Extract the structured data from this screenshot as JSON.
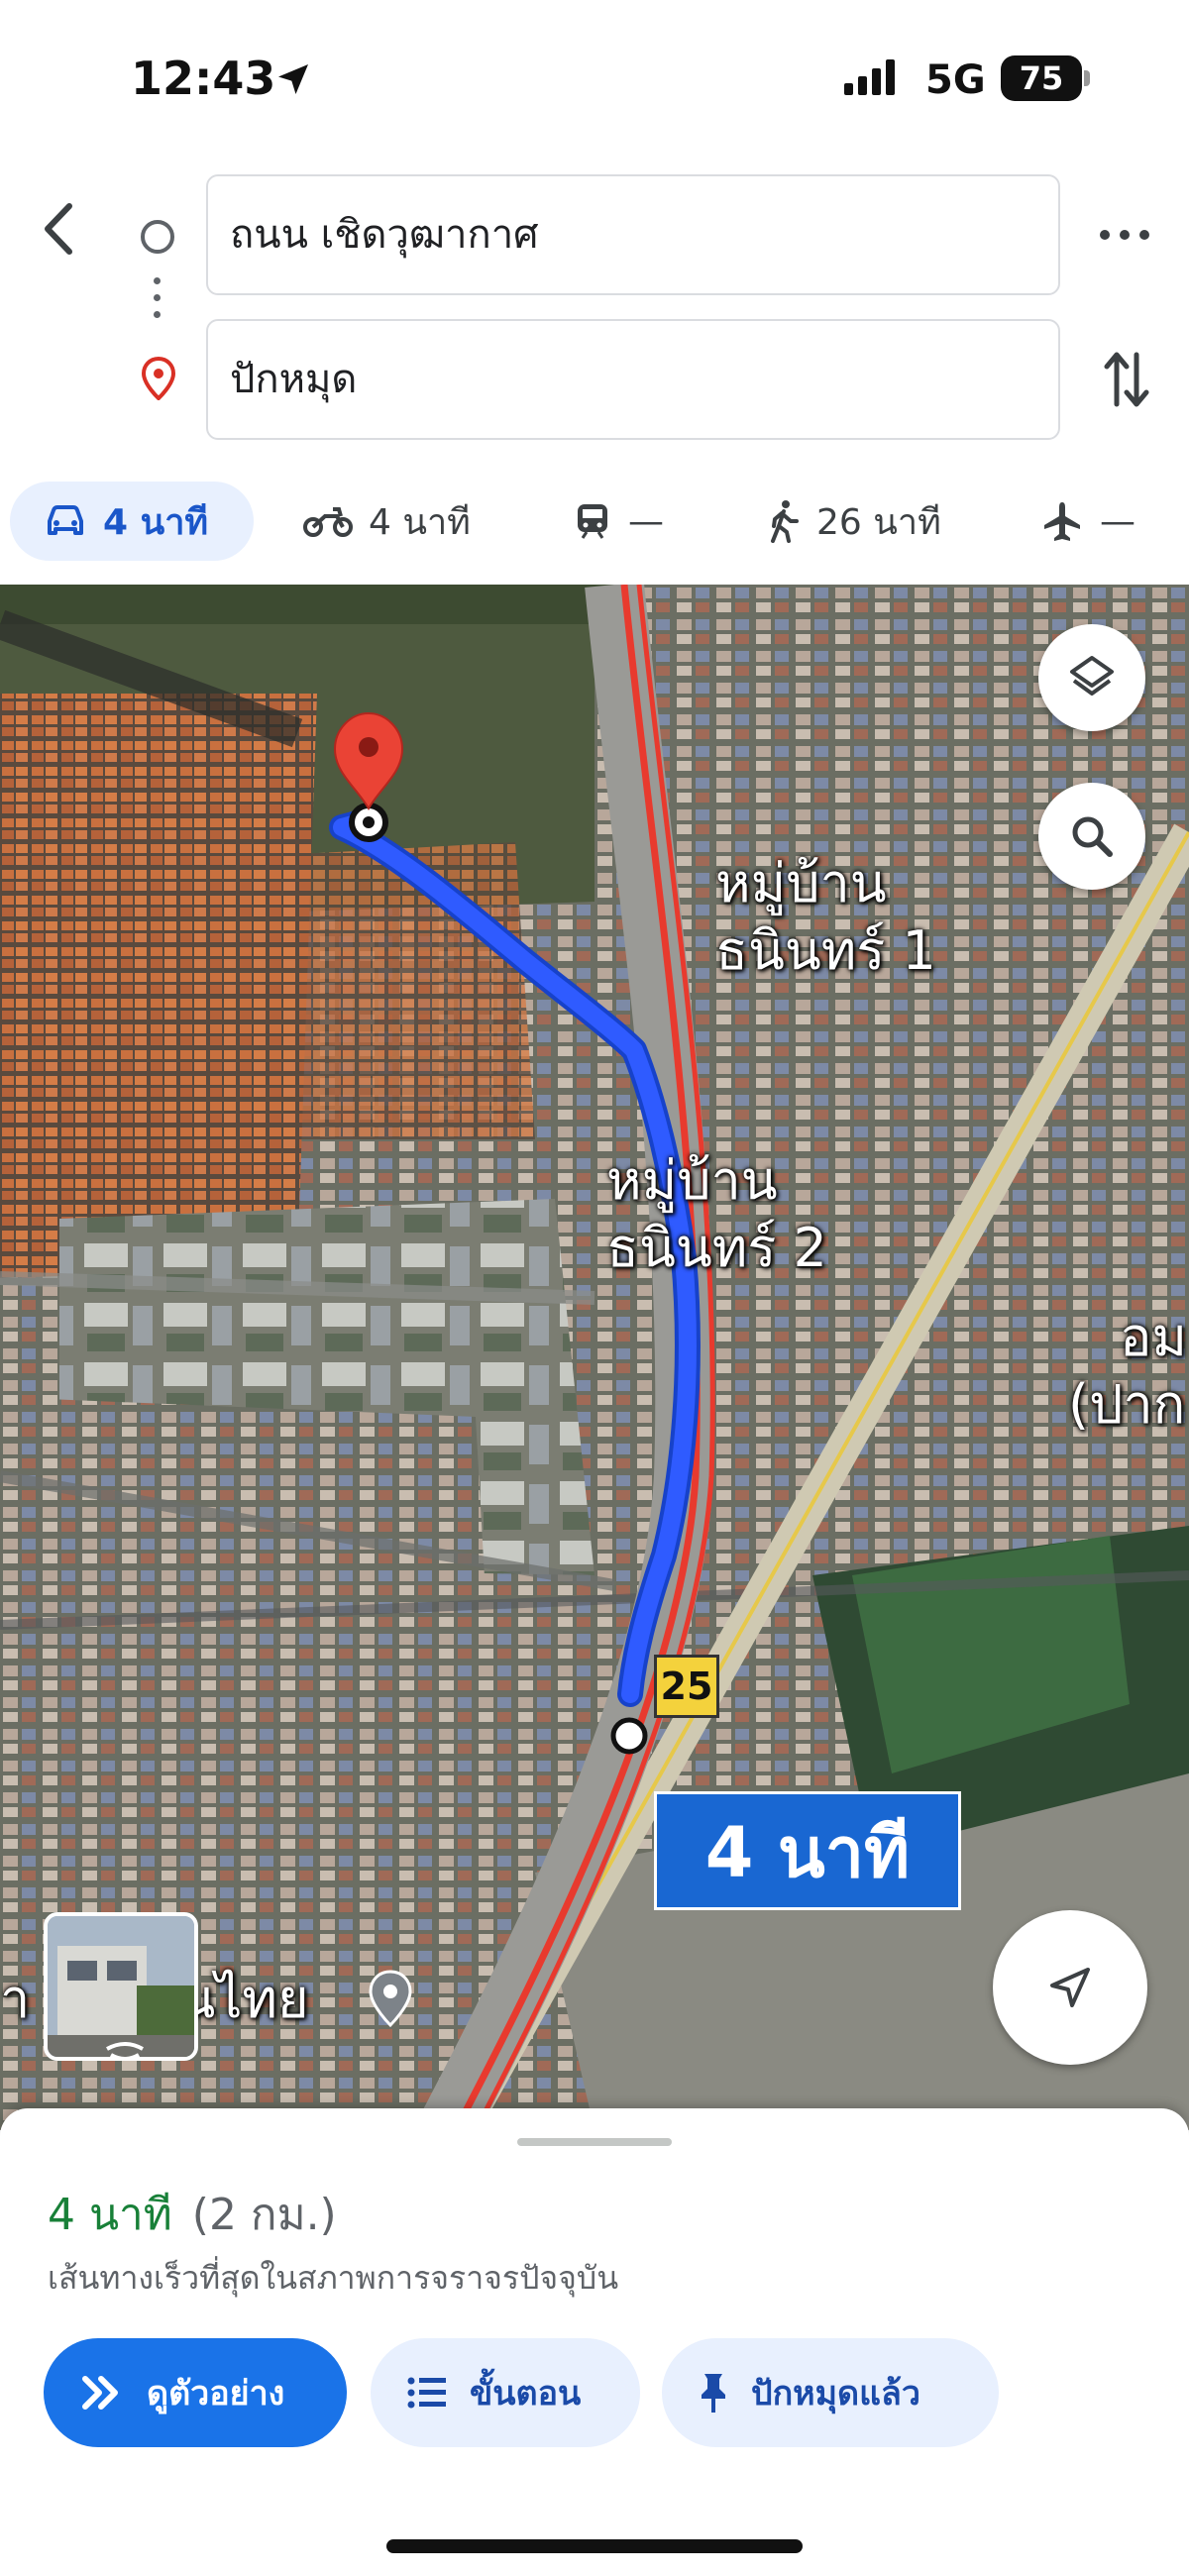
{
  "status_bar": {
    "time": "12:43",
    "network": "5G",
    "battery": "75"
  },
  "directions": {
    "origin": "ถนน เชิดวุฒากาศ",
    "destination": "ปักหมุด"
  },
  "modes": [
    {
      "name": "car",
      "label": "4 นาที",
      "selected": true
    },
    {
      "name": "motorbike",
      "label": "4 นาที"
    },
    {
      "name": "transit",
      "label": "—"
    },
    {
      "name": "walk",
      "label": "26 นาที"
    },
    {
      "name": "flight",
      "label": "—"
    }
  ],
  "map": {
    "labels": {
      "village1_line1": "หมู่บ้าน",
      "village1_line2": "ธนินทร์ 1",
      "village2_line1": "หมู่บ้าน",
      "village2_line2": "ธนินทร์ 2",
      "partial_right_line1": "อม",
      "partial_right_line2": "(ปาก",
      "partial_bottom": "า",
      "partial_bottom2": "นไทย"
    },
    "route_eta": "4 นาที",
    "highway_shield": "25",
    "route_color": "#2f5bff"
  },
  "sheet": {
    "eta": "4 นาที",
    "distance": "(2 กม.)",
    "note": "เส้นทางเร็วที่สุดในสภาพการจราจรปัจจุบัน",
    "buttons": {
      "preview": "ดูตัวอย่าง",
      "steps": "ขั้นตอน",
      "pinned": "ปักหมุดแล้ว"
    }
  },
  "colors": {
    "accent": "#1a73e8",
    "eta_green": "#188038",
    "chip_bg": "#e8f0fe"
  }
}
